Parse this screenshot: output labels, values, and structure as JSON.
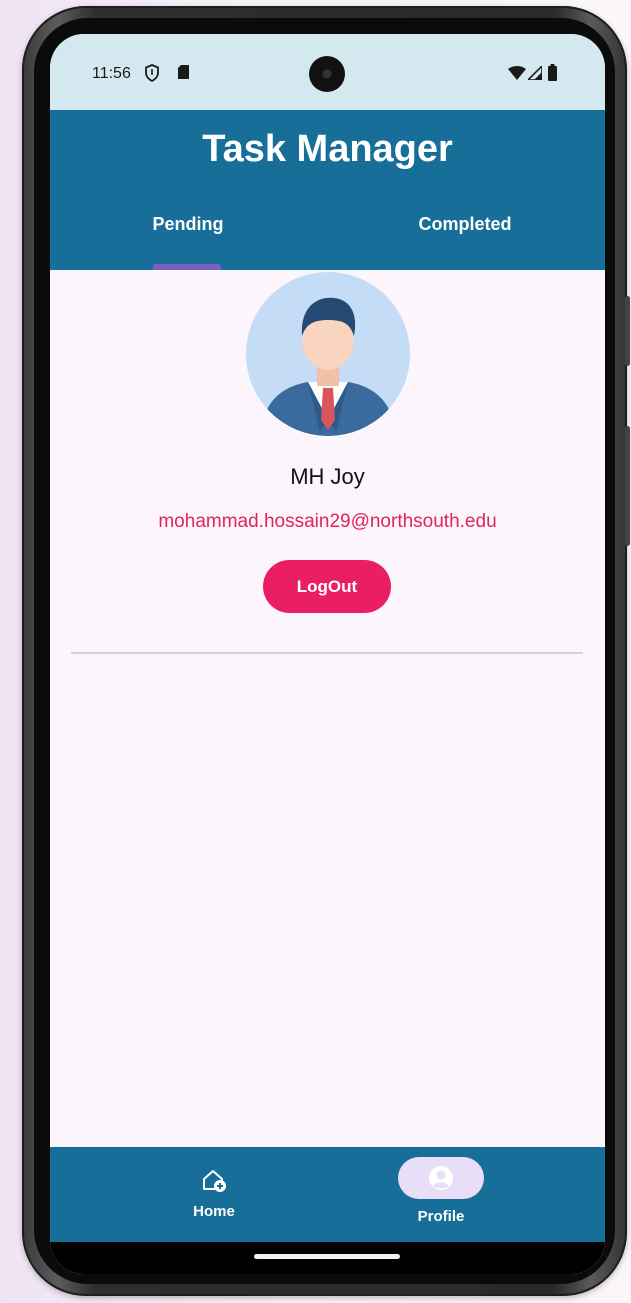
{
  "status_bar": {
    "time": "11:56"
  },
  "app_bar": {
    "title": "Task Manager"
  },
  "tabs": [
    {
      "label": "Pending",
      "selected": true
    },
    {
      "label": "Completed",
      "selected": false
    }
  ],
  "profile": {
    "name": "MH Joy",
    "email": "mohammad.hossain29@northsouth.edu",
    "logout_label": "LogOut"
  },
  "bottom_nav": [
    {
      "label": "Home",
      "icon": "home-add-icon",
      "selected": false
    },
    {
      "label": "Profile",
      "icon": "account-circle-icon",
      "selected": true
    }
  ],
  "colors": {
    "primary": "#176f99",
    "accent": "#e91e63",
    "background": "#fcf5fc",
    "status_bar": "#d3e9ef"
  }
}
